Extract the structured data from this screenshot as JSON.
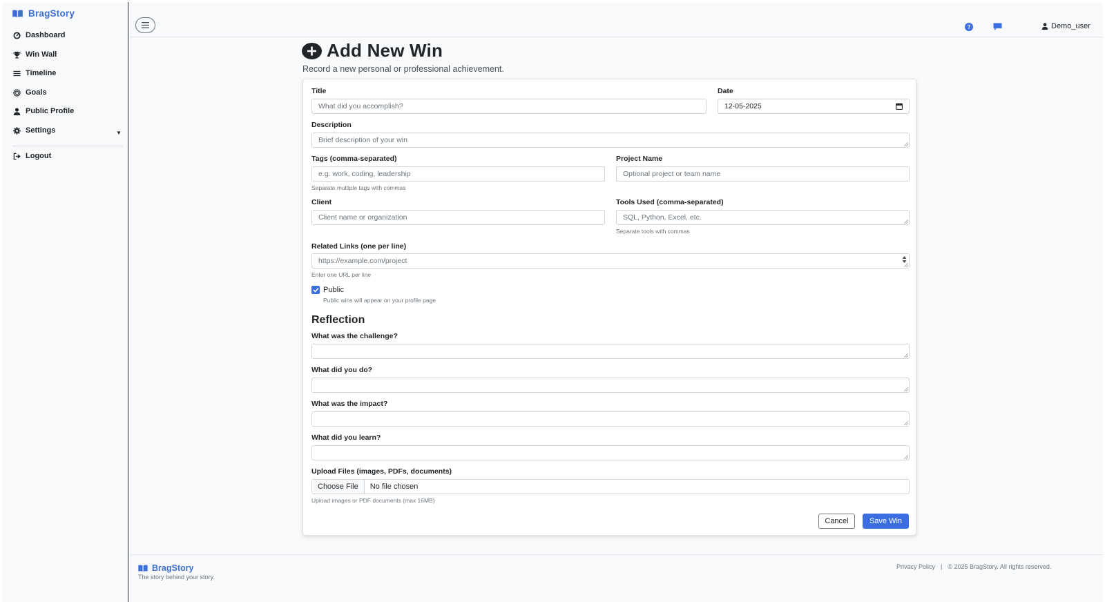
{
  "app": {
    "name": "BragStory"
  },
  "sidebar": {
    "items": [
      {
        "label": "Dashboard",
        "icon": "dashboard-icon"
      },
      {
        "label": "Win Wall",
        "icon": "trophy-icon"
      },
      {
        "label": "Timeline",
        "icon": "list-icon"
      },
      {
        "label": "Goals",
        "icon": "target-icon"
      },
      {
        "label": "Public Profile",
        "icon": "user-icon"
      },
      {
        "label": "Settings",
        "icon": "gear-icon"
      },
      {
        "label": "Logout",
        "icon": "logout-icon"
      }
    ]
  },
  "topbar": {
    "user": "Demo_user"
  },
  "page": {
    "title": "Add New Win",
    "subtitle": "Record a new personal or professional achievement."
  },
  "form": {
    "title_label": "Title",
    "title_placeholder": "What did you accomplish?",
    "date_label": "Date",
    "date_value": "12-05-2025",
    "description_label": "Description",
    "description_placeholder": "Brief description of your win",
    "tags_label": "Tags (comma-separated)",
    "tags_placeholder": "e.g. work, coding, leadership",
    "tags_help": "Separate multiple tags with commas",
    "project_label": "Project Name",
    "project_placeholder": "Optional project or team name",
    "client_label": "Client",
    "client_placeholder": "Client name or organization",
    "tools_label": "Tools Used (comma-separated)",
    "tools_placeholder": "SQL, Python, Excel, etc.",
    "tools_help": "Separate tools with commas",
    "links_label": "Related Links (one per line)",
    "links_placeholder": "https://example.com/project",
    "links_help": "Enter one URL per line",
    "public_label": "Public",
    "public_checked": true,
    "public_help": "Public wins will appear on your profile page",
    "reflection_title": "Reflection",
    "challenge_label": "What was the challenge?",
    "did_label": "What did you do?",
    "impact_label": "What was the impact?",
    "learn_label": "What did you learn?",
    "upload_label": "Upload Files (images, PDFs, documents)",
    "upload_button": "Choose File",
    "upload_status": "No file chosen",
    "upload_help": "Upload images or PDF documents (max 16MB)",
    "cancel_label": "Cancel",
    "save_label": "Save Win"
  },
  "footer": {
    "brand": "BragStory",
    "tagline": "The story behind your story.",
    "privacy": "Privacy Policy",
    "separator": "|",
    "copyright": "© 2025 BragStory. All rights reserved."
  },
  "colors": {
    "accent": "#3b6ee0",
    "brand": "#3d6fd6"
  }
}
